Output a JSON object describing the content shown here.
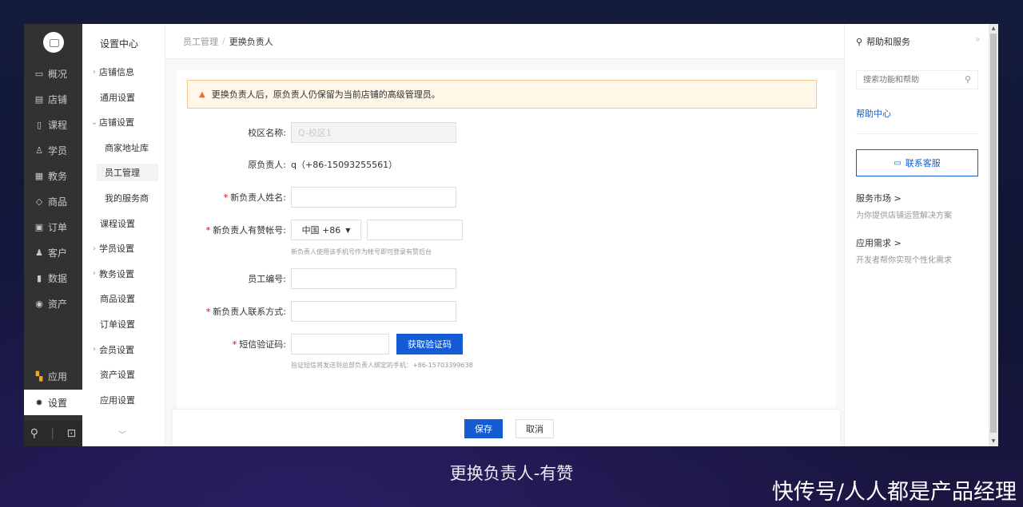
{
  "nav": {
    "items": [
      {
        "icon": "overview-icon",
        "glyph": "▭",
        "label": "概况"
      },
      {
        "icon": "store-icon",
        "glyph": "▤",
        "label": "店铺"
      },
      {
        "icon": "course-icon",
        "glyph": "▯",
        "label": "课程"
      },
      {
        "icon": "student-icon",
        "glyph": "♙",
        "label": "学员"
      },
      {
        "icon": "teaching-icon",
        "glyph": "▦",
        "label": "教务"
      },
      {
        "icon": "goods-icon",
        "glyph": "◇",
        "label": "商品"
      },
      {
        "icon": "order-icon",
        "glyph": "▣",
        "label": "订单"
      },
      {
        "icon": "customer-icon",
        "glyph": "♟",
        "label": "客户"
      },
      {
        "icon": "data-icon",
        "glyph": "▮",
        "label": "数据"
      },
      {
        "icon": "assets-icon",
        "glyph": "◉",
        "label": "资产"
      }
    ],
    "apps_label": "应用",
    "settings_label": "设置"
  },
  "subnav": {
    "title": "设置中心",
    "items": [
      {
        "label": "店铺信息",
        "arrow": "›"
      },
      {
        "label": "通用设置",
        "arrow": ""
      },
      {
        "label": "店铺设置",
        "arrow": "⌄"
      },
      {
        "label": "商家地址库",
        "arrow": "",
        "child": true
      },
      {
        "label": "员工管理",
        "arrow": "",
        "child": true,
        "selected": true
      },
      {
        "label": "我的服务商",
        "arrow": "",
        "child": true
      },
      {
        "label": "课程设置",
        "arrow": ""
      },
      {
        "label": "学员设置",
        "arrow": "›"
      },
      {
        "label": "教务设置",
        "arrow": "›"
      },
      {
        "label": "商品设置",
        "arrow": ""
      },
      {
        "label": "订单设置",
        "arrow": ""
      },
      {
        "label": "会员设置",
        "arrow": "›"
      },
      {
        "label": "资产设置",
        "arrow": ""
      },
      {
        "label": "应用设置",
        "arrow": ""
      }
    ]
  },
  "header": {
    "crumb_parent": "员工管理",
    "crumb_sep": "/",
    "crumb_current": "更换负责人"
  },
  "notice": {
    "text": "更换负责人后，原负责人仍保留为当前店铺的高级管理员。"
  },
  "form": {
    "campus_label": "校区名称:",
    "campus_value": "Q-校区1",
    "original_label": "原负责人:",
    "original_value": "q（+86-15093255561）",
    "new_name_label": "新负责人姓名:",
    "new_account_label": "新负责人有赞帐号:",
    "country_code": "中国 +86",
    "account_help": "新负责人使用该手机号作为帐号即可登录有赞后台",
    "employee_no_label": "员工编号:",
    "contact_label": "新负责人联系方式:",
    "sms_label": "短信验证码:",
    "get_code_button": "获取验证码",
    "sms_help": "验证短信将发送到总部负责人绑定的手机：+86-15703399638",
    "required_mark": "*"
  },
  "footer": {
    "save_label": "保存",
    "cancel_label": "取消"
  },
  "help_panel": {
    "title": "帮助和服务",
    "search_placeholder": "搜索功能和帮助",
    "help_center": "帮助中心",
    "contact_button": "联系客服",
    "market_title": "服务市场 >",
    "market_desc": "为你提供店铺运营解决方案",
    "demand_title": "应用需求 >",
    "demand_desc": "开发者帮你实现个性化需求"
  },
  "caption": "更换负责人-有赞",
  "watermark": "快传号/人人都是产品经理",
  "colors": {
    "primary": "#155bd4",
    "nav_bg": "#323233",
    "notice_bg": "#fff7e8",
    "warning": "#e8712e",
    "required": "#d40000"
  }
}
